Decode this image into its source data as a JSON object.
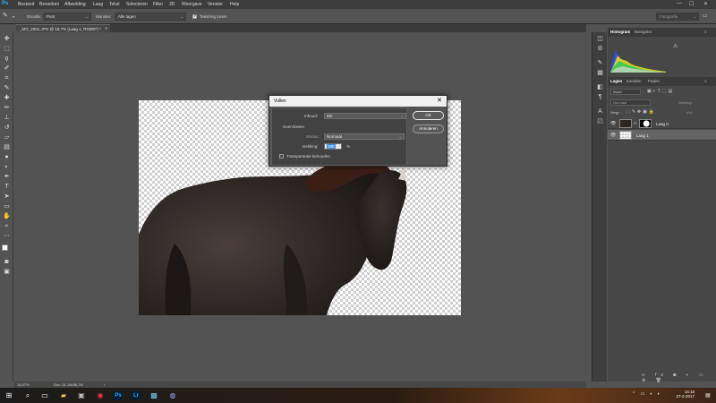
{
  "app": {
    "logo": "Ps"
  },
  "menu": [
    "Bestand",
    "Bewerken",
    "Afbeelding",
    "Laag",
    "Tekst",
    "Selecteren",
    "Filter",
    "3D",
    "Weergave",
    "Venster",
    "Help"
  ],
  "window_controls": {
    "minimize": "—",
    "maximize": "☐",
    "close": "✕"
  },
  "options_bar": {
    "grootte_label": "Grootte:",
    "grootte_value": "Punt",
    "monster_label": "Monster:",
    "monster_value": "Alle lagen",
    "ring_label": "Tekstring tonen",
    "ring_checked": true,
    "search_placeholder": "Fotografie"
  },
  "document": {
    "tab_title": "_MG_2001.JPG @ 16,7% (Laag 1, RGB/8*) *",
    "tab_close": "×",
    "zoom_status": "16,67%",
    "doc_status": "Doc: 51,1M/86,7M"
  },
  "toolbar_icons": [
    "move-icon",
    "marquee-icon",
    "lasso-icon",
    "quick-select-icon",
    "crop-icon",
    "eyedropper-icon",
    "healing-icon",
    "brush-icon",
    "stamp-icon",
    "history-brush-icon",
    "eraser-icon",
    "gradient-icon",
    "blur-icon",
    "dodge-icon",
    "pen-icon",
    "type-icon",
    "path-select-icon",
    "shape-icon",
    "hand-icon",
    "zoom-icon",
    "more-icon"
  ],
  "panels": {
    "histogram_tabs": [
      "Histogram",
      "Navigator"
    ],
    "layers_tabs": [
      "Lagen",
      "Kanalen",
      "Paden"
    ],
    "layers_search_label": "Soort",
    "blend_mode": "Normaal",
    "opacity_label": "Dekking:",
    "lock_label": "Vergr.:",
    "fill_label": "Vul:",
    "layers": [
      {
        "name": "Laag 0",
        "visible": true,
        "selected": false
      },
      {
        "name": "Laag 1",
        "visible": true,
        "selected": true
      }
    ]
  },
  "dialog": {
    "title": "Vullen",
    "close": "✕",
    "inhoud_label": "Inhoud:",
    "inhoud_value": "Wit",
    "overvloeien_label": "Overvloeien",
    "modus_label": "Modus:",
    "modus_value": "Normaal",
    "dekking_label": "Dekking:",
    "dekking_value": "100",
    "dekking_unit": "%",
    "transparantie_label": "Transparantie behouden",
    "ok_label": "OK",
    "cancel_label": "Annuleren"
  },
  "taskbar": {
    "time": "14:18",
    "date": "27-2-2017"
  },
  "colors": {
    "ps_blue": "#31a8ff",
    "panel_dark": "#3a3a3a",
    "workspace": "#535353",
    "horse": "#2b2420"
  }
}
